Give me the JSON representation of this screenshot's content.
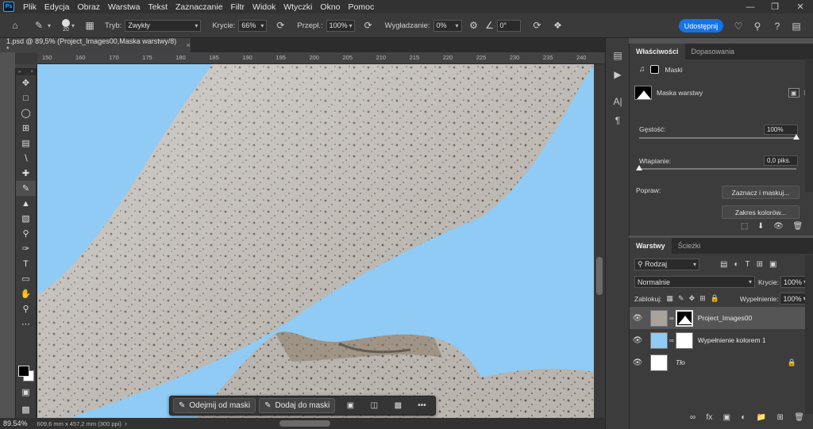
{
  "menubar": {
    "logo": "Ps",
    "items": [
      "Plik",
      "Edycja",
      "Obraz",
      "Warstwa",
      "Tekst",
      "Zaznaczanie",
      "Filtr",
      "Widok",
      "Wtyczki",
      "Okno",
      "Pomoc"
    ]
  },
  "options": {
    "brush_size": "20",
    "mode_label": "Tryb:",
    "mode_value": "Zwykły",
    "opacity_label": "Krycie:",
    "opacity_value": "66%",
    "flow_label": "Przepł.:",
    "flow_value": "100%",
    "smoothing_label": "Wygładzanie:",
    "smoothing_value": "0%",
    "angle_value": "0°",
    "share_label": "Udostępnij"
  },
  "document": {
    "tab_title": "1.psd @ 89,5% (Project_Images00,Maska warstwy/8) *",
    "ruler_ticks": [
      "150",
      "160",
      "170",
      "175",
      "180",
      "185",
      "190",
      "195",
      "200",
      "205",
      "210",
      "215",
      "220",
      "225",
      "230",
      "235",
      "240"
    ]
  },
  "status": {
    "zoom": "89.54%",
    "doc_info": "609,6 mm x 457,2 mm (300 ppi)"
  },
  "maskbar": {
    "subtract_label": "Odejmij od maski",
    "add_label": "Dodaj do maski",
    "more": "•••"
  },
  "properties": {
    "tabs": [
      "Właściwości",
      "Dopasowania"
    ],
    "section": "Maski",
    "mask_title": "Maska warstwy",
    "density_label": "Gęstość:",
    "density_value": "100%",
    "density_level": 1.0,
    "feather_label": "Wtapianie:",
    "feather_value": "0,0 piks.",
    "feather_level": 0.0,
    "refine_label": "Popraw:",
    "select_mask_button": "Zaznacz i maskuj...",
    "color_range_button": "Zakres kolorów..."
  },
  "layers": {
    "tabs": [
      "Warstwy",
      "Ścieżki"
    ],
    "filter_label": "Rodzaj",
    "blend_mode": "Normalnie",
    "opacity_label": "Krycie:",
    "opacity_value": "100%",
    "lock_label": "Zablokuj:",
    "fill_label": "Wypełnienie:",
    "fill_value": "100%",
    "items": [
      {
        "name": "Project_Images00",
        "selected": true
      },
      {
        "name": "Wypełnienie kolorem 1",
        "selected": false
      },
      {
        "name": "Tło",
        "selected": false
      }
    ]
  },
  "colors": {
    "sky": "#8fcbf4",
    "accent": "#1473e6",
    "fill_layer": "#8fcbf4"
  }
}
